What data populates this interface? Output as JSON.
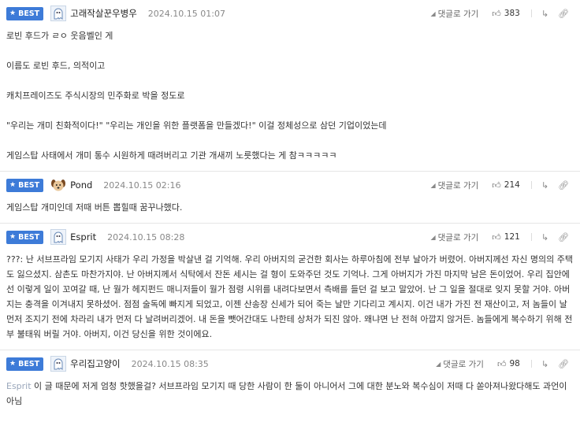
{
  "ui": {
    "best_label": "BEST",
    "reply_label": "댓글로 가기"
  },
  "comments": [
    {
      "nickname": "고래작살꾼우병우",
      "date": "2024.10.15 01:07",
      "votes": "383",
      "avatar": "ghost-avatar",
      "paragraphs": [
        "로빈 후드가 ㄹㅇ 웃음벨인 게",
        "이름도 로빈 후드, 의적이고",
        "캐치프레이즈도 주식시장의 민주화로 박을 정도로",
        "\"우리는 개미 친화적이다!\" \"우리는 개인을 위한 플랫폼을 만들겠다!\" 이걸 정체성으로 삼던 기업이었는데",
        "게임스탑 사태에서 개미 통수 시원하게 때려버리고 기관 개새끼 노릇했다는 게 참ㅋㅋㅋㅋㅋ"
      ]
    },
    {
      "nickname": "Pond",
      "date": "2024.10.15 02:16",
      "votes": "214",
      "avatar": "dog-avatar",
      "paragraphs": [
        "게임스탑 개미인데 저때 버튼 뽑힐때 꿈꾸나했다."
      ]
    },
    {
      "nickname": "Esprit",
      "date": "2024.10.15 08:28",
      "votes": "121",
      "avatar": "ghost-avatar",
      "text": "???: 난 서브프라임 모기지 사태가 우리 가정을 박살낸 걸 기억해. 우리 아버지의 굳건한 회사는 하루아침에 전부 날아가 버렸어. 아버지께선 자신 명의의 주택도 잃으셨지. 삼촌도 마찬가지야. 난 아버지께서 식탁에서 잔돈 세시는 걸 형이 도와주던 것도 기억나. 그게 아버지가 가진 마지막 남은 돈이었어. 우리 집안에선 이렇게 일이 꼬여갈 때, 난 월가 헤지펀드 매니저들이 월가 점령 시위를 내려다보면서 측배를 들던 걸 보고 말았어. 난 그 일을 절대로 잊지 못할 거야. 아버지는 충격을 이겨내지 못하셨어. 점점 술독에 빠지게 되었고, 이젠 산송장 신세가 되어 죽는 날만 기다리고 계시지. 이건 내가 가진 전 재산이고, 저 놈들이 날 먼저 조지기 전에 차라리 내가 먼저 다 날려버리겠어. 내 돈을 뺏어간대도 나한테 상처가 되진 않아. 왜냐면 난 전혀 아깝지 않거든. 놈들에게 복수하기 위해 전부 불태워 버릴 거야. 아버지, 이건 당신을 위한 것이에요."
    },
    {
      "nickname": "우리집고양이",
      "date": "2024.10.15 08:35",
      "votes": "98",
      "avatar": "ghost-avatar",
      "mention": "Esprit",
      "text": " 이 글 때문에 저게 엄청 핫했을걸? 서브프라임 모기지 때 당한 사람이 한 둘이 아니어서 그에 대한 분노와 복수심이 저때 다 쏟아져나왔다해도 과언이 아님"
    }
  ]
}
